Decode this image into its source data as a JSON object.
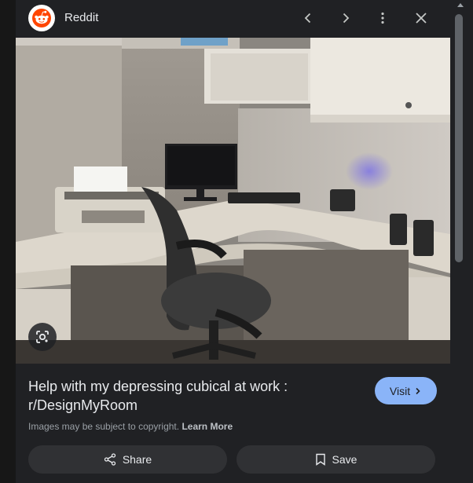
{
  "header": {
    "site_name": "Reddit",
    "icons": [
      "reddit-logo",
      "chevron-left-icon",
      "chevron-right-icon",
      "more-vert-icon",
      "close-icon"
    ]
  },
  "image": {
    "description_icon": "lens-icon"
  },
  "result": {
    "title": "Help with my depressing cubical at work : r/DesignMyRoom",
    "visit_label": "Visit",
    "copyright_text": "Images may be subject to copyright.",
    "learn_more": "Learn More"
  },
  "actions": {
    "share_label": "Share",
    "save_label": "Save"
  },
  "colors": {
    "panel_bg": "#202124",
    "visit_bg": "#8ab4f8",
    "action_bg": "#303134",
    "reddit_orange": "#ff4500"
  }
}
